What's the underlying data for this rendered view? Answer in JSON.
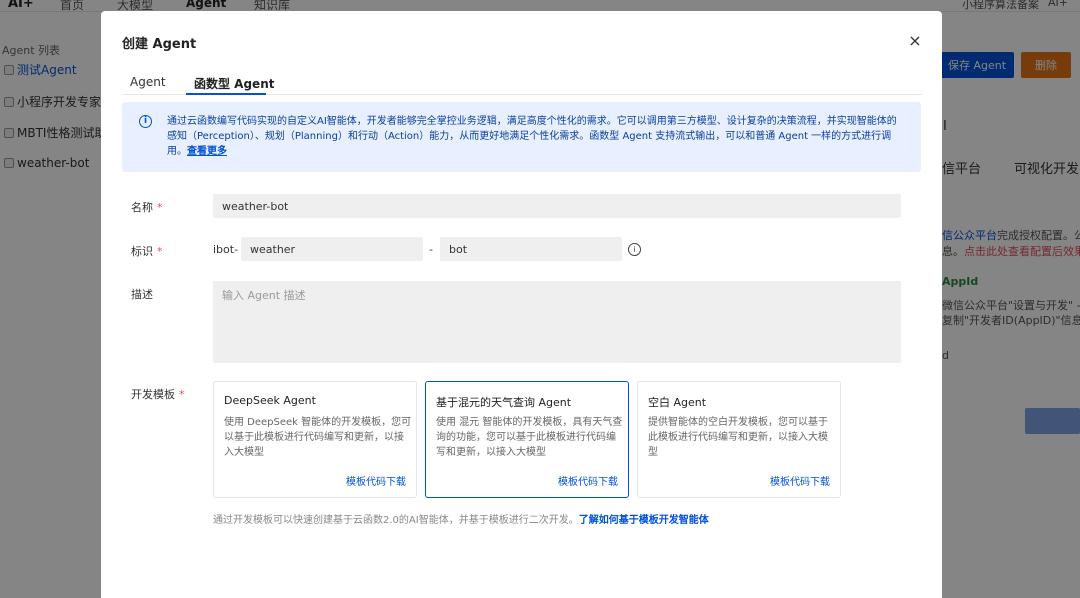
{
  "background": {
    "brand": "AI+",
    "nav": [
      "首页",
      "大模型",
      "Agent",
      "知识库"
    ],
    "top_right": [
      "小程序算法备案",
      "AI+"
    ],
    "sidebar_title": "Agent 列表",
    "sidebar_items": [
      "测试Agent",
      "小程序开发专家",
      "MBTI性格测试助",
      "weather-bot"
    ],
    "save_button": "保存 Agent",
    "delete_button": "删除",
    "right_fragments": {
      "letter": "I",
      "tab1": "信平台",
      "tab2": "可视化开发",
      "line1a": "信公众平台",
      "line1b": "完成授权配置。公",
      "line2a": "息。",
      "line2b": "点击此处查看配置后效果。",
      "appid": "AppId",
      "line3": "微信公众平台\"设置与开发\" -",
      "line4": "复制\"开发者ID(AppID)\"信息",
      "line5": "d"
    }
  },
  "modal": {
    "title": "创建 Agent",
    "close_icon": "×",
    "tabs": [
      "Agent",
      "函数型 Agent"
    ],
    "info": {
      "icon": "i",
      "text": "通过云函数编写代码实现的自定义AI智能体，开发者能够完全掌控业务逻辑，满足高度个性化的需求。它可以调用第三方模型、设计复杂的决策流程，并实现智能体的感知（Perception）、规划（Planning）和行动（Action）能力，从而更好地满足个性化需求。函数型 Agent 支持流式输出，可以和普通 Agent 一样的方式进行调用。",
      "link": "查看更多"
    },
    "form": {
      "name_label": "名称",
      "name_value": "weather-bot",
      "id_label": "标识",
      "id_prefix": "ibot-",
      "id_part1": "weather",
      "id_separator": "-",
      "id_part2": "bot",
      "help_icon": "i",
      "desc_label": "描述",
      "desc_placeholder": "输入 Agent 描述",
      "template_label": "开发模板",
      "required_mark": "*"
    },
    "templates": [
      {
        "title": "DeepSeek Agent",
        "desc": "使用 DeepSeek 智能体的开发模板，您可以基于此模板进行代码编写和更新，以接入大模型",
        "link": "模板代码下载"
      },
      {
        "title": "基于混元的天气查询 Agent",
        "desc": "使用 混元 智能体的开发模板，具有天气查询的功能，您可以基于此模板进行代码编写和更新，以接入大模型",
        "link": "模板代码下载"
      },
      {
        "title": "空白 Agent",
        "desc": "提供智能体的空白开发模板，您可以基于此模板进行代码编写和更新，以接入大模型",
        "link": "模板代码下载"
      }
    ],
    "footer": {
      "hint": "通过开发模板可以快速创建基于云函数2.0的AI智能体，并基于模板进行二次开发。",
      "link": "了解如何基于模板开发智能体"
    }
  },
  "colors": {
    "primary": "#0052d9",
    "danger": "#e34d59",
    "info_bg": "#e8f0ff"
  }
}
